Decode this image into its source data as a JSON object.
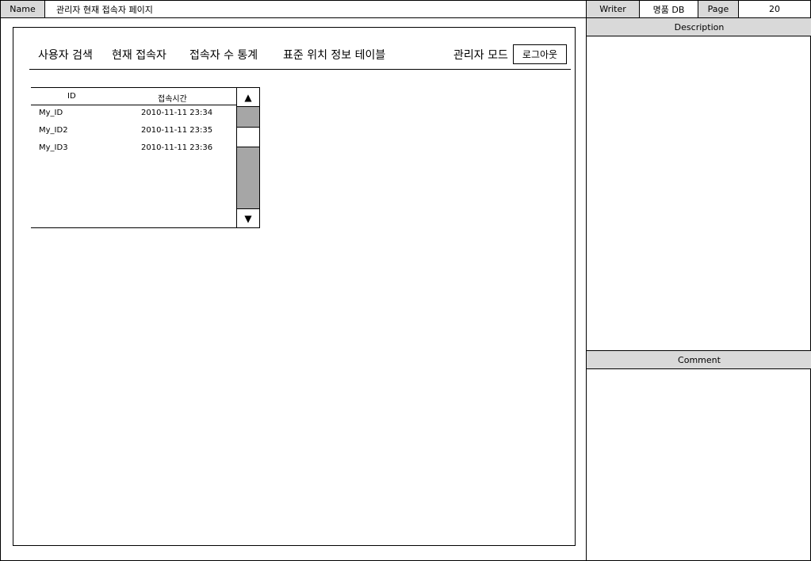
{
  "header": {
    "name_label": "Name",
    "name_value": "관리자 현재 접속자 페이지",
    "writer_label": "Writer",
    "writer_value": "명품 DB",
    "page_label": "Page",
    "page_value": "20"
  },
  "right_panel": {
    "description_title": "Description",
    "comment_title": "Comment"
  },
  "nav": {
    "items": [
      "사용자 검색",
      "현재 접속자",
      "접속자 수 통계",
      "표준 위치 정보 테이블"
    ],
    "admin_mode": "관리자 모드",
    "logout": "로그아웃"
  },
  "table": {
    "columns": [
      "ID",
      "접속시간"
    ],
    "rows": [
      {
        "id": "My_ID",
        "time": "2010-11-11 23:34"
      },
      {
        "id": "My_ID2",
        "time": "2010-11-11 23:35"
      },
      {
        "id": "My_ID3",
        "time": "2010-11-11 23:36"
      }
    ],
    "scroll_up": "▲",
    "scroll_down": "▼"
  }
}
